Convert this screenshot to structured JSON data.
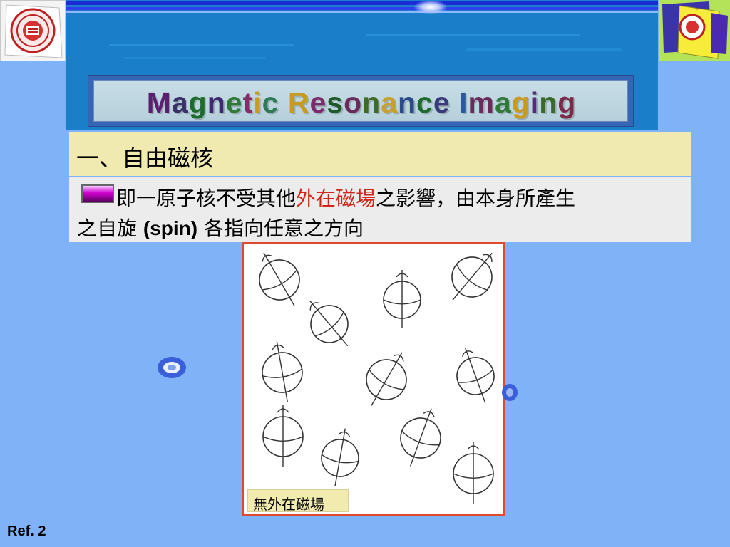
{
  "slide": {
    "title_letters": [
      {
        "ch": "M",
        "color": "#5a1f6e"
      },
      {
        "ch": "a",
        "color": "#3a3068"
      },
      {
        "ch": "g",
        "color": "#1f6b2e"
      },
      {
        "ch": "n",
        "color": "#3f2a72"
      },
      {
        "ch": "e",
        "color": "#2f7a36"
      },
      {
        "ch": "t",
        "color": "#8a2a6a"
      },
      {
        "ch": "i",
        "color": "#c89a1e"
      },
      {
        "ch": "c",
        "color": "#2f7a56"
      },
      {
        "ch": " ",
        "color": "#000000"
      },
      {
        "ch": "R",
        "color": "#c89a1e"
      },
      {
        "ch": "e",
        "color": "#7d2a6a"
      },
      {
        "ch": "s",
        "color": "#1f5a26"
      },
      {
        "ch": "o",
        "color": "#6b2a5a"
      },
      {
        "ch": "n",
        "color": "#3f6a2a"
      },
      {
        "ch": "a",
        "color": "#c8a030"
      },
      {
        "ch": "n",
        "color": "#2a4a8a"
      },
      {
        "ch": "c",
        "color": "#1f6a2e"
      },
      {
        "ch": "e",
        "color": "#3a3a7a"
      },
      {
        "ch": " ",
        "color": "#000000"
      },
      {
        "ch": "I",
        "color": "#2a5a9a"
      },
      {
        "ch": "m",
        "color": "#6a2a5a"
      },
      {
        "ch": "a",
        "color": "#2f7a36"
      },
      {
        "ch": "g",
        "color": "#c89a1e"
      },
      {
        "ch": "i",
        "color": "#5a2a7a"
      },
      {
        "ch": "n",
        "color": "#3a6a2a"
      },
      {
        "ch": "g",
        "color": "#7d2a4a"
      }
    ],
    "section_title": "一、自由磁核",
    "body": {
      "line1_before": "即一原子核不受其他",
      "line1_highlight": "外在磁場",
      "line1_after": "之影響，由本身所產生",
      "line2_before": "之自旋 ",
      "line2_bold": "(spin)",
      "line2_after": " 各指向任意之方向"
    },
    "figure_caption": "無外在磁場",
    "ref_label": "Ref. 2"
  },
  "colors": {
    "background": "#7fb2f6",
    "header_band": "#1a7ec8",
    "section_bg": "#f0eab0",
    "body_bg": "#ececec",
    "highlight": "#d0261a",
    "figure_border": "#e0492a"
  },
  "icons": {
    "bullet": "magenta-bar-bullet-icon",
    "logo_left": "university-seal-icon",
    "logo_right": "college-emblem-icon",
    "decoration": "blue-blob-icon"
  }
}
